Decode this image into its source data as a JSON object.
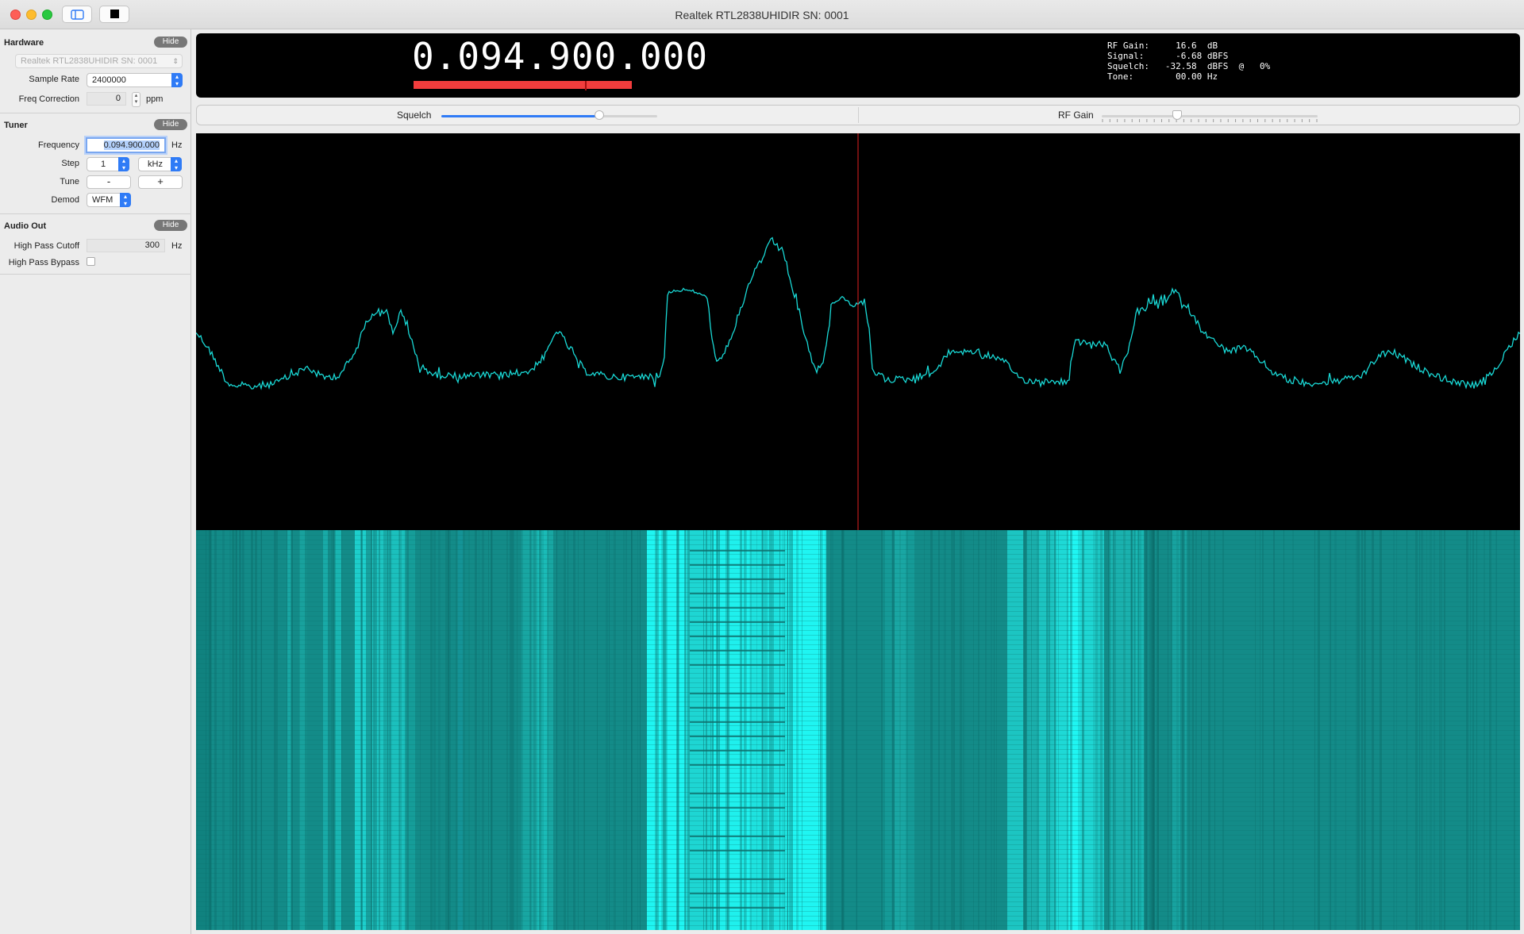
{
  "window": {
    "title": "Realtek RTL2838UHIDIR SN: 0001"
  },
  "sidebar": {
    "hardware": {
      "title": "Hardware",
      "hide_label": "Hide",
      "device": "Realtek RTL2838UHIDIR SN: 0001",
      "sample_rate_label": "Sample Rate",
      "sample_rate": "2400000",
      "freq_correction_label": "Freq Correction",
      "freq_correction": "0",
      "freq_correction_unit": "ppm"
    },
    "tuner": {
      "title": "Tuner",
      "hide_label": "Hide",
      "frequency_label": "Frequency",
      "frequency": "0.094.900.000",
      "frequency_unit": "Hz",
      "step_label": "Step",
      "step_value": "1",
      "step_unit": "kHz",
      "tune_label": "Tune",
      "tune_minus": "-",
      "tune_plus": "+",
      "demod_label": "Demod",
      "demod": "WFM"
    },
    "audio_out": {
      "title": "Audio Out",
      "hide_label": "Hide",
      "high_pass_cutoff_label": "High Pass Cutoff",
      "high_pass_cutoff": "300",
      "high_pass_cutoff_unit": "Hz",
      "high_pass_bypass_label": "High Pass Bypass",
      "high_pass_bypass_checked": false
    }
  },
  "display": {
    "frequency": "0.094.900.000",
    "stats_text": "RF Gain:     16.6  dB\nSignal:      -6.68 dBFS\nSquelch:   -32.58  dBFS  @   0%\nTone:        00.00 Hz"
  },
  "controls": {
    "squelch_label": "Squelch",
    "squelch_level": 0.73,
    "rf_gain_label": "RF Gain",
    "rf_gain_level": 0.35
  },
  "colors": {
    "spectrum_trace": "#19d9d6",
    "center_marker": "#e0201f",
    "waterfall_base": "#138b88",
    "waterfall_hot": "#1ff5f2",
    "accent": "#2f7bf6",
    "level_bar": "#f23d3d"
  }
}
